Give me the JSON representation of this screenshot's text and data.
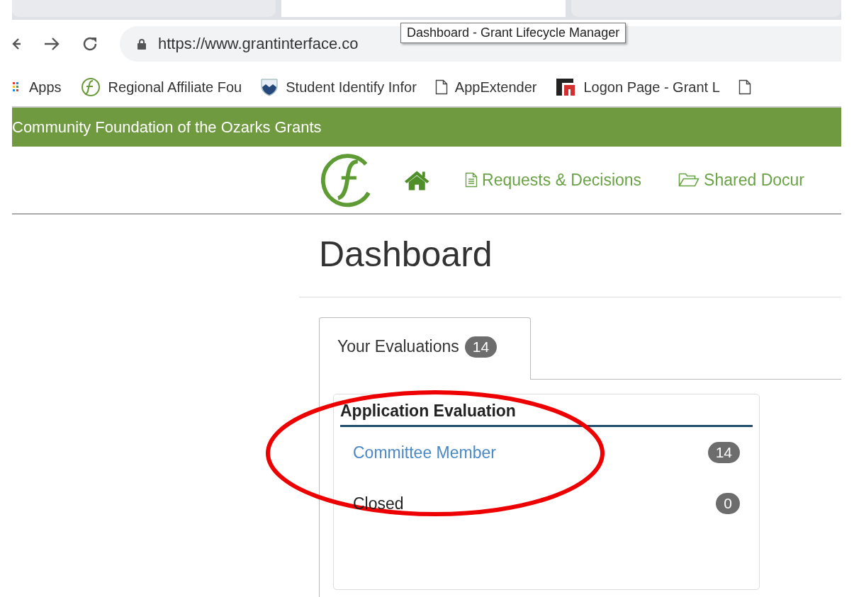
{
  "browser": {
    "tabs": [
      {
        "selected": false
      },
      {
        "selected": true
      },
      {
        "selected": false
      }
    ],
    "url": "https://www.grantinterface.co",
    "tooltip": "Dashboard - Grant Lifecycle Manager",
    "bookmarks": [
      {
        "label": "Apps",
        "kind": "apps"
      },
      {
        "label": "Regional Affiliate Fou",
        "kind": "logo"
      },
      {
        "label": "Student Identify Infor",
        "kind": "shield"
      },
      {
        "label": "AppExtender",
        "kind": "page"
      },
      {
        "label": "Logon Page - Grant L",
        "kind": "brand"
      },
      {
        "kind": "page"
      }
    ]
  },
  "site": {
    "banner": "Community Foundation of the Ozarks Grants",
    "nav": [
      {
        "kind": "home"
      },
      {
        "label": "Requests & Decisions",
        "kind": "document"
      },
      {
        "label": "Shared Docur",
        "kind": "folder"
      }
    ]
  },
  "heading": "Dashboard",
  "tabs": [
    {
      "label": "Your Evaluations",
      "count": "14",
      "selected": true
    }
  ],
  "panel": {
    "title": "Application Evaluation",
    "rows": [
      {
        "label": "Committee Member",
        "count": "14",
        "kind": "link"
      },
      {
        "label": "Closed",
        "count": "0",
        "kind": "plain"
      }
    ]
  }
}
